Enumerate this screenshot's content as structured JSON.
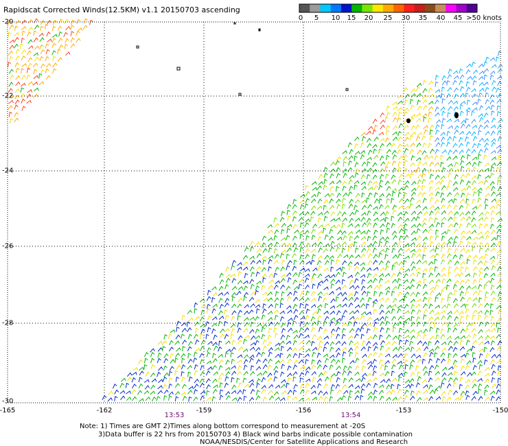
{
  "title": "Rapidscat Corrected Winds(12.5KM) v1.1 20150703 ascending",
  "speed_scale": {
    "colors": [
      "#555555",
      "#9a9a9a",
      "#00c8ff",
      "#0078ff",
      "#0014c8",
      "#00b400",
      "#7ae600",
      "#ffe600",
      "#ffaa00",
      "#ff6400",
      "#ff1e1e",
      "#c81e1e",
      "#8a4a1a",
      "#c88c5a",
      "#ff00ff",
      "#a000c8",
      "#500096"
    ],
    "labels": [
      "0",
      "5",
      "10",
      "15",
      "20",
      "25",
      "30",
      "35",
      "40",
      "45",
      ">50 knots"
    ]
  },
  "map": {
    "lat_labels": [
      "-20",
      "-22",
      "-24",
      "-26",
      "-28",
      "-30"
    ],
    "lon_labels": [
      "-165",
      "-162",
      "-159",
      "-156",
      "-153",
      "-150"
    ],
    "times": [
      "13:53",
      "13:54"
    ]
  },
  "notes": {
    "line1": "Note: 1) Times are GMT 2)Times along bottom correspond to measurement at -20S",
    "line2": "3)Data buffer is 22 hrs from 20150703 4) Black wind barbs indicate possible contamination",
    "line3": "NOAA/NESDIS/Center for Satellite Applications and Research"
  }
}
